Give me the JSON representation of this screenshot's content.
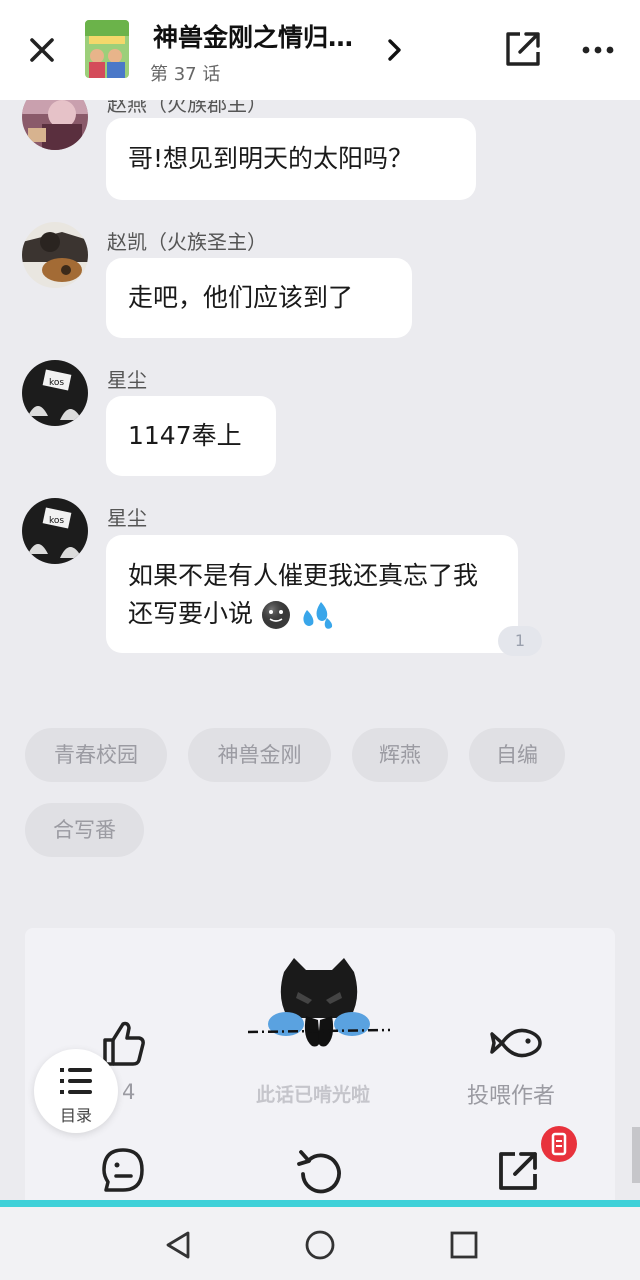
{
  "header": {
    "title": "神兽金刚之情归…",
    "episode": "第 37 话"
  },
  "messages": [
    {
      "sender": "赵燕（火族郡主）",
      "text": "哥!想见到明天的太阳吗？"
    },
    {
      "sender": "赵凯（火族圣主）",
      "text": "走吧，他们应该到了"
    },
    {
      "sender": "星尘",
      "text": "1147奉上"
    },
    {
      "sender": "星尘",
      "text": "如果不是有人催更我还真忘了我还写要小说",
      "reply_count": "1"
    }
  ],
  "tags": [
    "青春校园",
    "神兽金刚",
    "辉燕",
    "自编",
    "合写番"
  ],
  "actions": {
    "like_count": "4",
    "finished_text": "此话已啃光啦",
    "feed_label": "投喂作者",
    "toc_label": "目录"
  },
  "colors": {
    "background": "#ebebef",
    "bubble": "#ffffff",
    "badge": "#e8323c",
    "accent_line": "#3fd1d8"
  },
  "icons": {
    "close": "close-icon",
    "share": "share-icon",
    "more": "more-icon",
    "like": "thumbs-up-icon",
    "feed": "fish-icon",
    "comment": "comment-icon",
    "replay": "replay-icon",
    "toc": "list-icon"
  }
}
